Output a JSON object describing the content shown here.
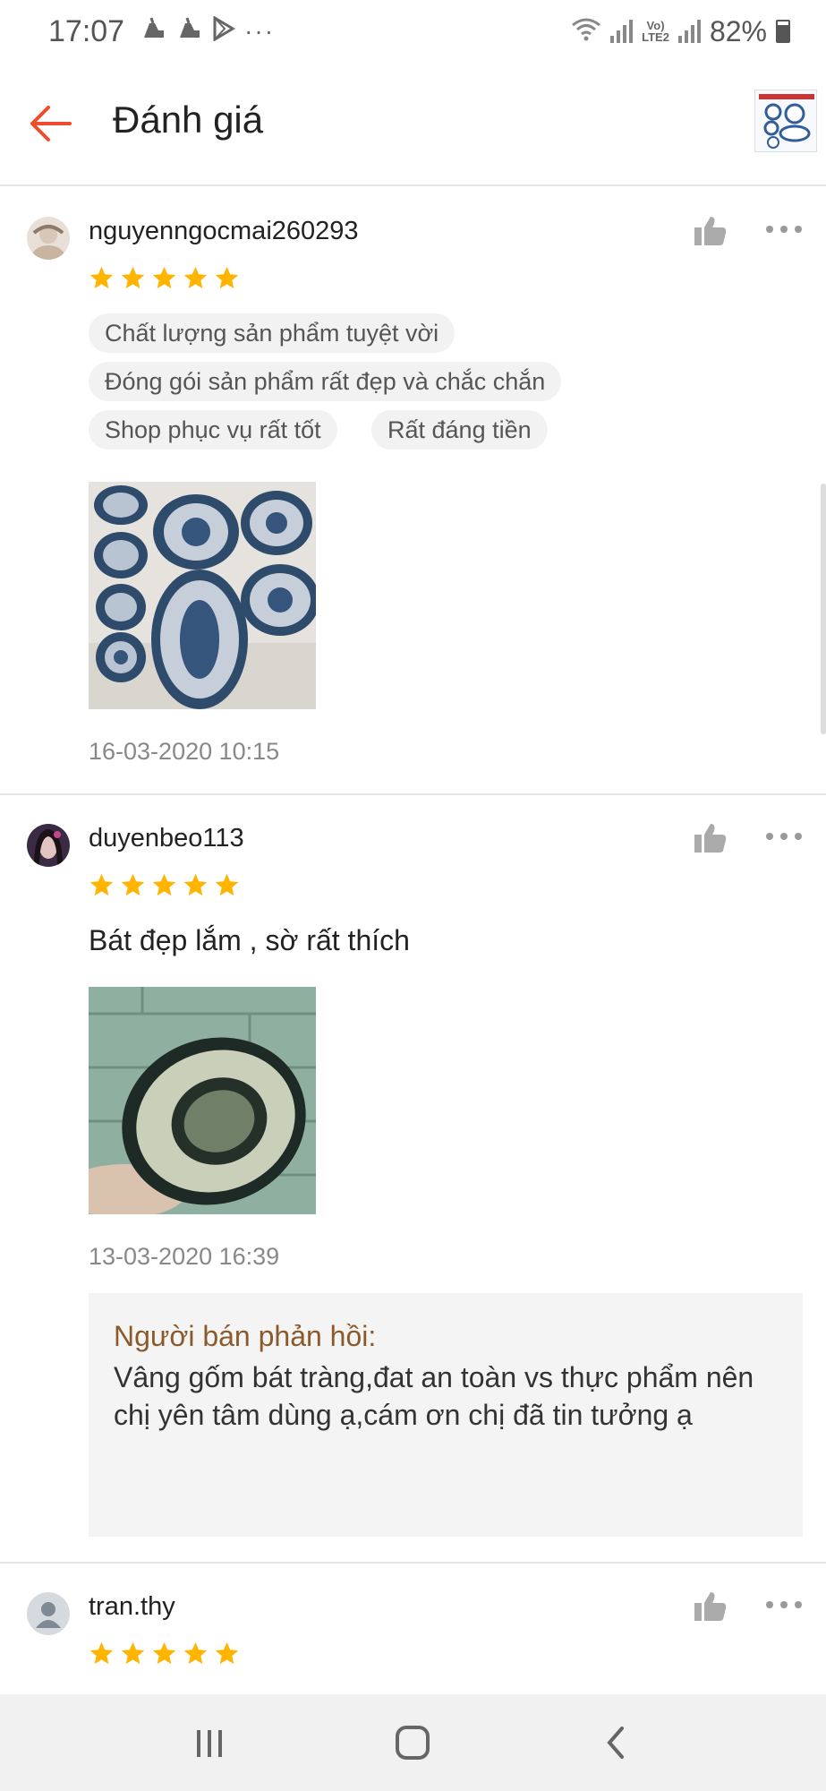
{
  "status_bar": {
    "time": "17:07",
    "battery": "82%",
    "network_label": "LTE2",
    "icons_left": [
      "notification-icon",
      "notification-icon",
      "play-store-icon",
      "more-dots-icon"
    ]
  },
  "app_bar": {
    "title": "Đánh giá",
    "back_icon": "arrow-left-icon",
    "accent_color": "#ee4d2d"
  },
  "reviews": [
    {
      "username": "nguyenngocmai260293",
      "rating": 5,
      "tags": [
        "Chất lượng sản phẩm tuyệt vời",
        "Đóng gói sản phẩm rất đẹp và chắc chắn",
        "Shop phục vụ rất tốt",
        "Rất đáng tiền"
      ],
      "date": "16-03-2020 10:15"
    },
    {
      "username": "duyenbeo113",
      "rating": 5,
      "text": "Bát đẹp lắm , sờ rất thích",
      "date": "13-03-2020 16:39",
      "seller_reply": {
        "title": "Người bán phản hồi:",
        "text": "Vâng gốm bát tràng,đat an toàn vs thực phẩm nên chị yên tâm dùng ạ,cám ơn chị đã tin tưởng ạ"
      }
    },
    {
      "username": "tran.thy",
      "rating": 5
    }
  ],
  "colors": {
    "star": "#ffb400",
    "reply_title": "#8b5a2b",
    "tag_bg": "#f2f2f2"
  }
}
